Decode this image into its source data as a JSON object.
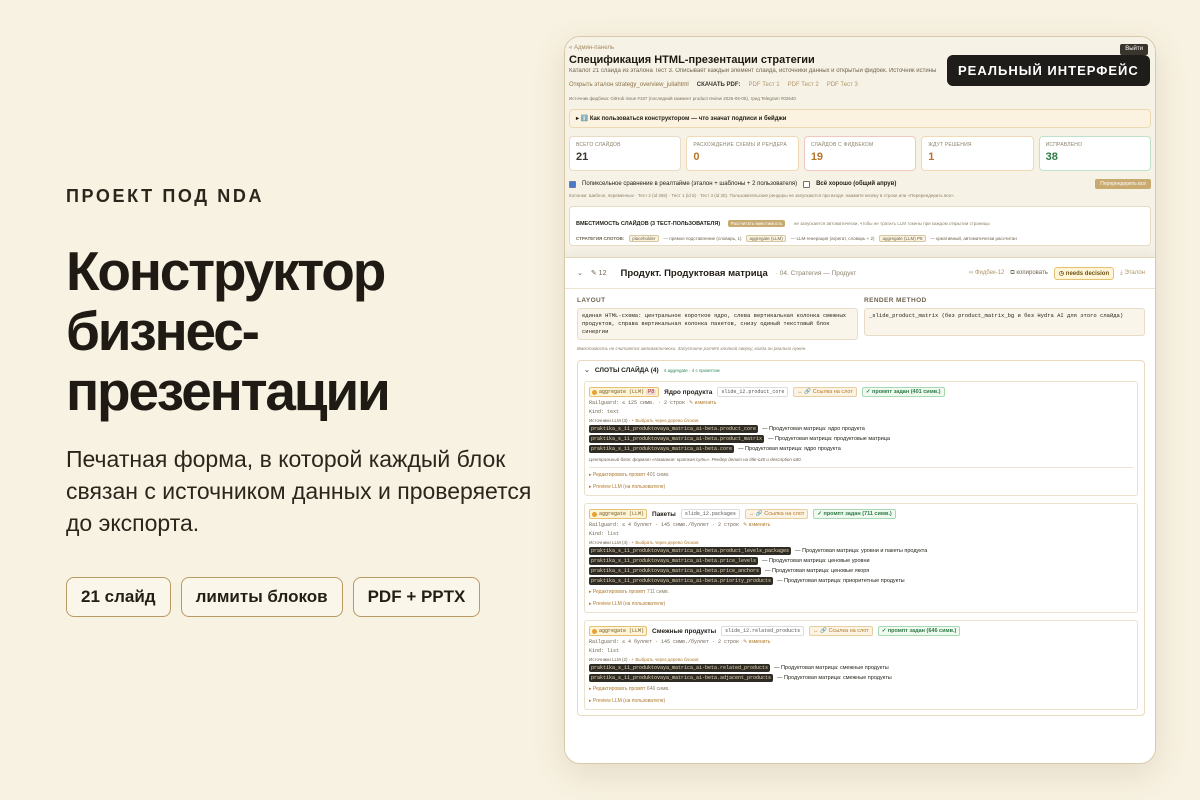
{
  "hero": {
    "eyebrow": "ПРОЕКТ ПОД NDA",
    "title_lines": [
      "Конструктор",
      "бизнес-",
      "презентации"
    ],
    "subtitle": "Печатная форма, в которой каждый блок связан с источником данных и проверяется до экспорта.",
    "chips": [
      "21 слайд",
      "лимиты блоков",
      "PDF + PPTX"
    ]
  },
  "badge": "РЕАЛЬНЫЙ ИНТЕРФЕЙС",
  "app": {
    "logout": "Выйти",
    "breadcrumb": "« Админ-панель",
    "page_title": "Спецификация HTML-презентации стратегии",
    "subtitle": "Каталог 21 слайда из эталона Тест 3. Описывает каждый элемент слайда, источники данных и открытый фидбек. Источник истины",
    "open_link": "Открыть эталон strategy_overview_juliahtml",
    "download_label": "СКАЧАТЬ PDF:",
    "pdf_links": [
      "PDF Тест 1",
      "PDF Тест 2",
      "PDF Тест 3"
    ],
    "contacts": "Источник фидбека: GitHub issue #187 (последний коммент product review 2026-05-05), тред Telegram #02640",
    "howto": "▸ ℹ️ Как пользоваться конструктором — что значат подписи и бейджи",
    "stats": [
      {
        "label": "ВСЕГО СЛАЙДОВ",
        "value": "21",
        "color": "#3a352c",
        "border": "#e8dcc6"
      },
      {
        "label": "РАСХОЖДЕНИЕ СХЕМЫ И РЕНДЕРА",
        "value": "0",
        "color": "#b8742a",
        "border": "#f0d9b5"
      },
      {
        "label": "СЛАЙДОВ С ФИДБЕКОМ",
        "value": "19",
        "color": "#b8742a",
        "border": "#f0c8c0"
      },
      {
        "label": "ЖДУТ РЕШЕНИЯ",
        "value": "1",
        "color": "#b8742a",
        "border": "#f0d9b5"
      },
      {
        "label": "ИСПРАВЛЕНО",
        "value": "38",
        "color": "#2e7a45",
        "border": "#bfe3c8"
      }
    ],
    "compare_label": "Попиксельное сравнение в реалтайме (эталон + шаблоны + 2 пользователя)",
    "all_good_label": "Всё хорошо (общий апрув)",
    "rerender_label": "Перерендерить все",
    "columns_line": "Колонки: Шаблон, переменных · Тест 2 (id 265) · Тест 1 (id 5) · Тест 3 (id 30). Пользовательские рендеры не запускаются при входе: нажмите кнопку в строке или «Перерендерить все».",
    "capacity": {
      "title": "ВМЕСТИМОСТЬ СЛАЙДОВ (3 ТЕСТ-ПОЛЬЗОВАТЕЛЯ)",
      "button": "Рассчитать вместимость",
      "note": "не запускается автоматически, чтобы не тратить LLM токены при каждом открытии страницы",
      "slots_label": "СТРАТЕГИЯ СЛОТОВ:",
      "slots": [
        "placeholder",
        "— прямое подставление (словарь, 1)",
        "aggregate (LLM)",
        "— LLM-генерация (агрегат, словарь + 2)",
        "aggregate (LLM) P8",
        "— креативный, автоматически рассчитан"
      ]
    }
  },
  "slide": {
    "number": "✎ 12",
    "title": "Продукт. Продуктовая матрица",
    "section": "· 04. Стратегия — Продукт",
    "feedback_link": "∞ Фидбек-12",
    "copy_link": "⧉ копировать",
    "status": "◷ needs decision",
    "fold": "⤓ Эталон",
    "layout_label": "LAYOUT",
    "layout_text": "единая HTML-схема: центральное короткое ядро, слева вертикальная колонка смежных продуктов, справа вертикальная колонка пакетов, снизу одиный текстовый блок синергии",
    "render_label": "RENDER METHOD",
    "render_text": "_slide_product_matrix (без product_matrix_bg и без Hydra AI для этого слайда)",
    "capacity_note": "Вместимость не считается автоматически. Запустите расчёт кнопкой сверху, когда он реально нужен.",
    "slots_title": "СЛОТЫ СЛАЙДА (4)",
    "slots_count": "4 aggregate · 4 с промптом",
    "cards": [
      {
        "agg": "aggregate (LLM)",
        "p8": "P8",
        "name": "Ядро продукта",
        "id": "slide_12.product_core",
        "link": "↔ 🔗 Ссылка на слот",
        "prompt": "✓ промпт задан (401 симв.)",
        "railguard": "Railguard: ≤ 125 симв. · 2 строк",
        "edit": "✎ изменить",
        "kind": "Kind: text",
        "sources_label": "Источники LLM (3)",
        "pick": "+ Выбрать через дерево блоков",
        "sources": [
          {
            "code": "praktika_s_11_produktovaya_matrica_ai-beta.product_core",
            "desc": "— Продуктовая матрица: ядро продукта"
          },
          {
            "code": "praktika_s_11_produktovaya_matrica_ai-beta.product_matrix",
            "desc": "— Продуктовая матрица: продуктовые матрица"
          },
          {
            "code": "praktika_s_11_produktovaya_matrica_ai-beta.core",
            "desc": "— Продуктовая матрица: ядро продукта"
          }
        ],
        "hint": "Центральный блок: формат «Название: краткая суть». Рендер делит на title ≤40 и description ≤80.",
        "edit_prompt": "▸ Редактировать промпт",
        "prompt_count": "401 симв.",
        "preview": "▸ Preview LLM (на пользователе)"
      },
      {
        "agg": "aggregate (LLM)",
        "p8": "",
        "name": "Пакеты",
        "id": "slide_12.packages",
        "link": "↔ 🔗 Ссылка на слот",
        "prompt": "✓ промпт задан (711 симв.)",
        "railguard": "Railguard: ≤ 4 буллет · 145 симв./буллет · 2 строк",
        "edit": "✎ изменить",
        "kind": "Kind: list",
        "sources_label": "Источники LLM (4)",
        "pick": "+ Выбрать через дерево блоков",
        "sources": [
          {
            "code": "praktika_s_11_produktovaya_matrica_ai-beta.product_levels_packages",
            "desc": "— Продуктовая матрица: уровни и пакеты продукта"
          },
          {
            "code": "praktika_s_11_produktovaya_matrica_ai-beta.price_levels",
            "desc": "— Продуктовая матрица: ценовые уровни"
          },
          {
            "code": "praktika_s_11_produktovaya_matrica_ai-beta.price_anchors",
            "desc": "— Продуктовая матрица: ценовые якоря"
          },
          {
            "code": "praktika_s_11_produktovaya_matrica_ai-beta.priority_products",
            "desc": "— Продуктовая матрица: приоритетные продукты"
          }
        ],
        "hint": "",
        "edit_prompt": "▸ Редактировать промпт",
        "prompt_count": "711 симв.",
        "preview": "▸ Preview LLM (на пользователе)"
      },
      {
        "agg": "aggregate (LLM)",
        "p8": "",
        "name": "Смежные продукты",
        "id": "slide_12.related_products",
        "link": "↔ 🔗 Ссылка на слот",
        "prompt": "✓ промпт задан (646 симв.)",
        "railguard": "Railguard: ≤ 4 буллет · 145 симв./буллет · 2 строк",
        "edit": "✎ изменить",
        "kind": "Kind: list",
        "sources_label": "Источники LLM (2)",
        "pick": "+ Выбрать через дерево блоков",
        "sources": [
          {
            "code": "praktika_s_11_produktovaya_matrica_ai-beta.related_products",
            "desc": "— Продуктовая матрица: смежные продукты"
          },
          {
            "code": "praktika_s_11_produktovaya_matrica_ai-beta.adjacent_products",
            "desc": "— Продуктовая матрица: смежные продукты"
          }
        ],
        "hint": "",
        "edit_prompt": "▸ Редактировать промпт",
        "prompt_count": "646 симв.",
        "preview": "▸ Preview LLM (на пользователе)"
      }
    ]
  }
}
